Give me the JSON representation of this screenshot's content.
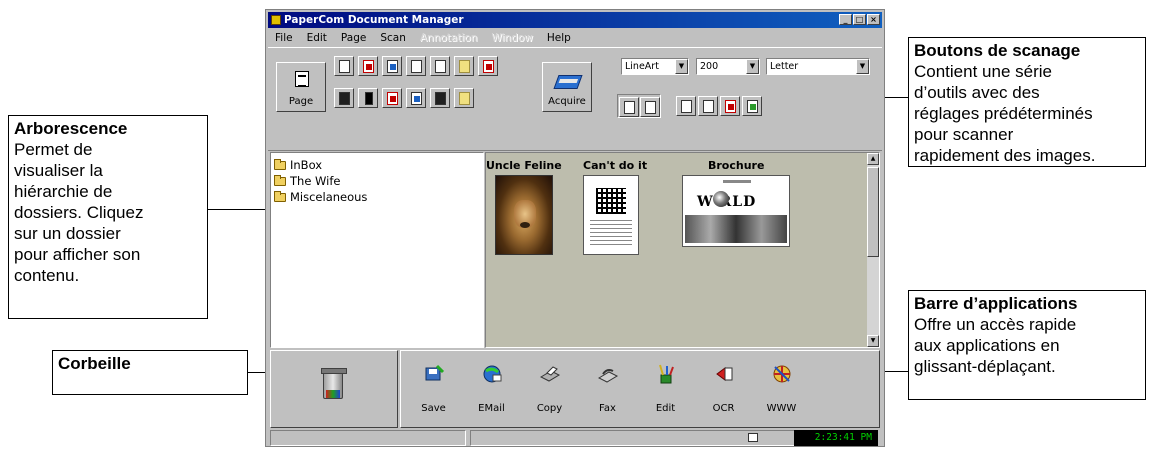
{
  "window": {
    "title": "PaperCom Document Manager",
    "controls": [
      "_",
      "□",
      "×"
    ]
  },
  "menu": {
    "items": [
      "File",
      "Edit",
      "Page",
      "Scan"
    ],
    "disabled_items": [
      "Annotation",
      "Window"
    ],
    "help": "Help"
  },
  "toolbar": {
    "page_label": "Page",
    "acquire_label": "Acquire",
    "scan_mode": "LineArt",
    "resolution": "200",
    "paper_size": "Letter"
  },
  "tree": {
    "folders": [
      "InBox",
      "The Wife",
      "Miscelaneous"
    ]
  },
  "thumbnails": {
    "titles": [
      "Uncle Feline",
      "Can't do it",
      "Brochure"
    ],
    "brochure_word": "W  RLD"
  },
  "appbar": {
    "apps": [
      "Save",
      "EMail",
      "Copy",
      "Fax",
      "Edit",
      "OCR",
      "WWW"
    ]
  },
  "status": {
    "clock": "2:23:41 PM"
  },
  "callouts": {
    "arborescence": {
      "title": "Arborescence",
      "lines": [
        "Permet de",
        "visualiser la",
        "hiérarchie de",
        "dossiers. Cliquez",
        "sur un dossier",
        "pour afficher son",
        "contenu."
      ]
    },
    "corbeille": {
      "title": "Corbeille"
    },
    "boutons": {
      "title": "Boutons de scanage",
      "lines": [
        "Contient une série",
        "d’outils avec des",
        "réglages prédéterminés",
        "pour scanner",
        "rapidement des images."
      ]
    },
    "barre": {
      "title": "Barre d’applications",
      "lines": [
        "Offre un accès rapide",
        "aux applications en",
        "glissant-déplaçant."
      ]
    }
  },
  "colors": {
    "titlebar": "#000a80",
    "window_bg": "#c0c0c0",
    "thumb_area": "#bdbdad",
    "clock_text": "#00d000"
  }
}
